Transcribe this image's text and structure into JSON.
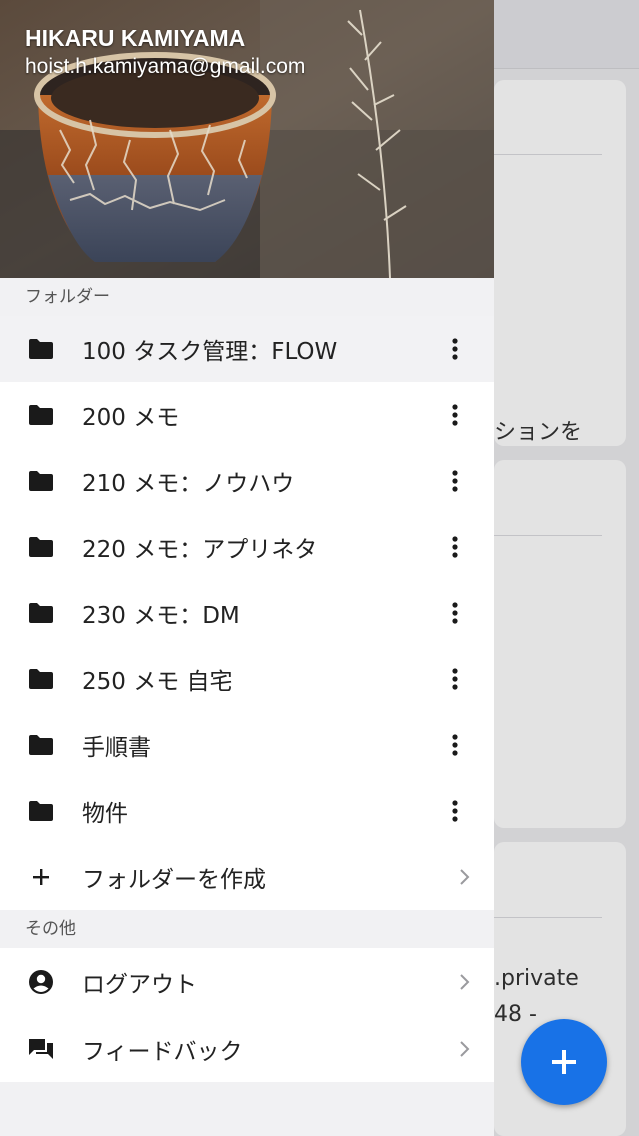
{
  "user": {
    "name": "HIKARU KAMIYAMA",
    "email": "hoist.h.kamiyama@gmail.com"
  },
  "sections": {
    "folders_label": "フォルダー",
    "other_label": "その他"
  },
  "folders": [
    {
      "label": "100 タスク管理：FLOW",
      "active": true
    },
    {
      "label": "200 メモ"
    },
    {
      "label": "210 メモ：ノウハウ"
    },
    {
      "label": "220 メモ：アプリネタ"
    },
    {
      "label": "230 メモ：DM"
    },
    {
      "label": "250 メモ 自宅"
    },
    {
      "label": "手順書"
    },
    {
      "label": "物件"
    }
  ],
  "create_folder_label": "フォルダーを作成",
  "other_items": [
    {
      "label": "ログアウト",
      "icon": "account-circle-icon"
    },
    {
      "label": "フィードバック",
      "icon": "feedback-icon"
    }
  ],
  "background": {
    "card1_snippet": "ションを",
    "card3_snippet_1": ".private",
    "card3_snippet_2": "48 -"
  },
  "colors": {
    "accent": "#1872e7"
  }
}
